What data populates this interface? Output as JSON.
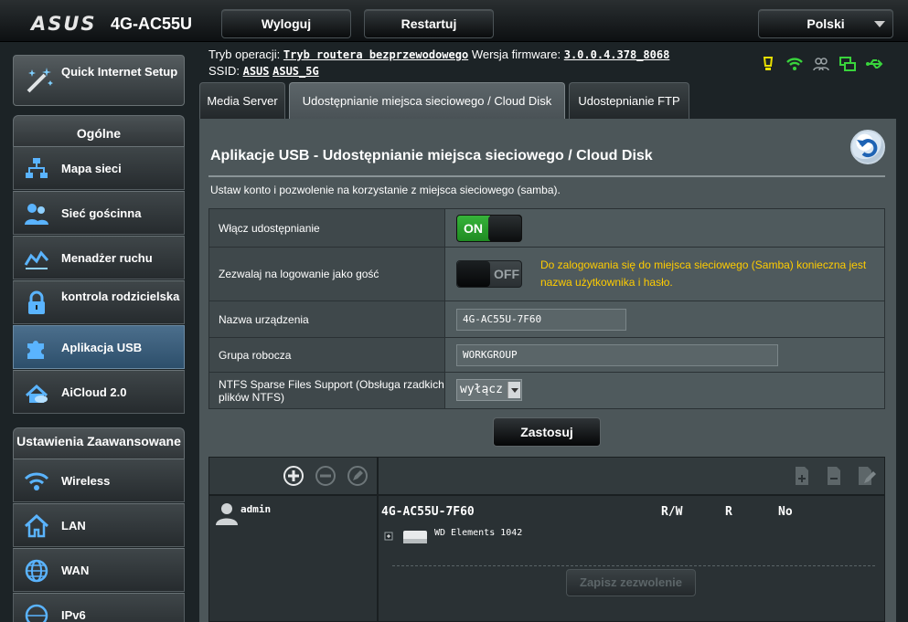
{
  "header": {
    "brand": "ASUS",
    "model": "4G-AC55U",
    "logout_label": "Wyloguj",
    "restart_label": "Restartuj",
    "language": "Polski"
  },
  "info": {
    "mode_label": "Tryb operacji:",
    "mode_value": "Tryb routera bezprzewodowego",
    "fw_label": "Wersja firmware:",
    "fw_value": "3.0.0.4.378_8068",
    "ssid_label": "SSID:",
    "ssid_1": "ASUS",
    "ssid_2": "ASUS_5G",
    "status_icons": [
      "bulb-icon",
      "wifi-icon",
      "users-icon",
      "network-icon",
      "usb-icon"
    ]
  },
  "sidebar": {
    "qis_label": "Quick Internet Setup",
    "general_title": "Ogólne",
    "general_items": [
      {
        "label": "Mapa sieci",
        "icon": "network-map-icon"
      },
      {
        "label": "Sieć gościnna",
        "icon": "guest-network-icon"
      },
      {
        "label": "Menadżer ruchu",
        "icon": "traffic-manager-icon"
      },
      {
        "label": "kontrola rodzicielska",
        "icon": "lock-icon"
      },
      {
        "label": "Aplikacja USB",
        "icon": "puzzle-icon"
      },
      {
        "label": "AiCloud 2.0",
        "icon": "cloud-house-icon"
      }
    ],
    "advanced_title": "Ustawienia Zaawansowane",
    "advanced_items": [
      {
        "label": "Wireless",
        "icon": "wireless-icon"
      },
      {
        "label": "LAN",
        "icon": "home-icon"
      },
      {
        "label": "WAN",
        "icon": "globe-icon"
      },
      {
        "label": "IPv6",
        "icon": "ipv6-icon"
      }
    ]
  },
  "tabs": [
    {
      "label": "Media Server"
    },
    {
      "label": "Udostępnianie miejsca sieciowego / Cloud Disk"
    },
    {
      "label": "Udostepnianie FTP"
    }
  ],
  "main": {
    "title": "Aplikacje USB - Udostępnianie miejsca sieciowego / Cloud Disk",
    "description": "Ustaw konto i pozwolenie na korzystanie z miejsca sieciowego (samba).",
    "rows": {
      "share_label": "Włącz udostępnianie",
      "share_state": "ON",
      "guest_label": "Zezwalaj na logowanie jako gość",
      "guest_state": "OFF",
      "guest_note": "Do zalogowania się do miejsca sieciowego (Samba) konieczna jest nazwa użytkownika i hasło.",
      "devname_label": "Nazwa urządzenia",
      "devname_value": "4G-AC55U-7F60",
      "workgroup_label": "Grupa robocza",
      "workgroup_value": "WORKGROUP",
      "ntfs_label": "NTFS Sparse Files Support (Obsługa rzadkich plików NTFS)",
      "ntfs_value": "wyłącz"
    },
    "apply_label": "Zastosuj",
    "acl": {
      "user": "admin",
      "device": "4G-AC55U-7F60",
      "perm_rw": "R/W",
      "perm_r": "R",
      "perm_no": "No",
      "disk": "WD Elements 1042",
      "save_label": "Zapisz zezwolenie"
    }
  }
}
